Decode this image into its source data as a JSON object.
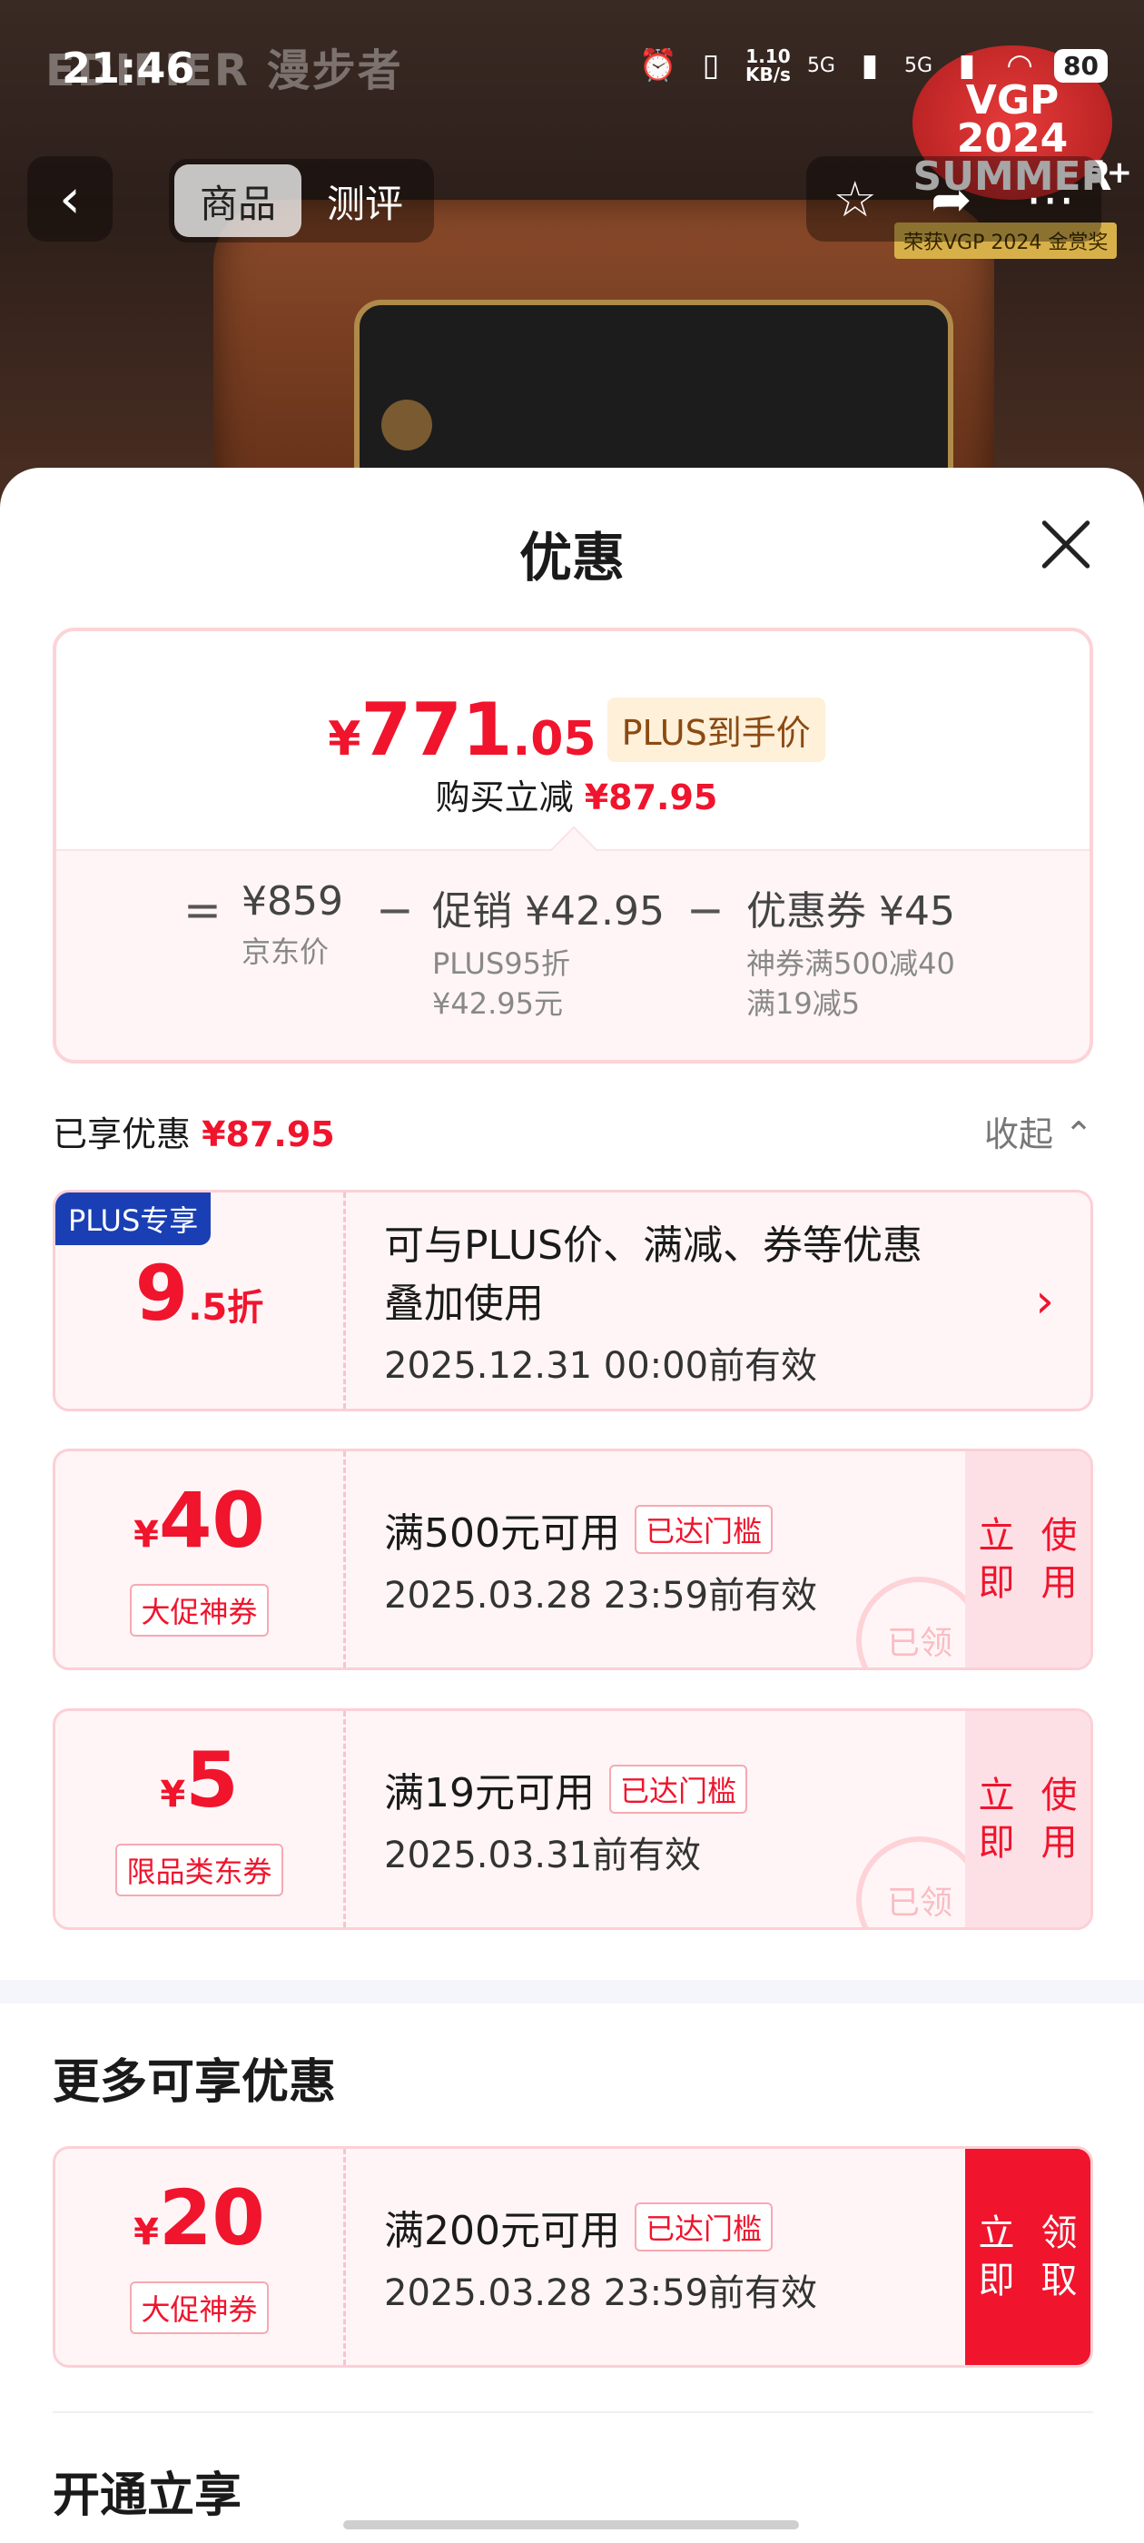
{
  "status_bar": {
    "time": "21:46",
    "net_speed_value": "1.10",
    "net_speed_unit": "KB/s",
    "sig1": "5G",
    "sig2": "5G",
    "battery": "80"
  },
  "header": {
    "brand": "EDIFIER 漫步者",
    "tabs": [
      {
        "label": "商品"
      },
      {
        "label": "测评"
      }
    ],
    "award_text": "VGP 2024 SUMMER",
    "award_count": "5+",
    "award_caption": "荣获VGP 2024 金赏奖"
  },
  "sheet": {
    "title": "优惠",
    "final_price": {
      "yen": "¥",
      "integer": "771",
      "decimal": ".05"
    },
    "plus_tag": "PLUS到手价",
    "buy_save_label": "购买立减",
    "buy_save_amount": "¥87.95",
    "calc": {
      "eq": "=",
      "minus": "−",
      "base_price": "¥859",
      "base_label": "京东价",
      "promo_label": "促销",
      "promo_amount": "¥42.95",
      "promo_note1": "PLUS95折",
      "promo_note2": "¥42.95元",
      "coupon_label": "优惠券",
      "coupon_amount": "¥45",
      "coupon_note1": "神券满500减40",
      "coupon_note2": "满19减5"
    },
    "enjoyed_label": "已享优惠",
    "enjoyed_amount": "¥87.95",
    "collapse_label": "收起"
  },
  "coupons": [
    {
      "badge": "PLUS专享",
      "amount_main": "9",
      "amount_suffix": ".5折",
      "condition": "可与PLUS价、满减、券等优惠",
      "condition2": "叠加使用",
      "valid": "2025.12.31 00:00前有效"
    },
    {
      "yen": "¥",
      "amount_main": "40",
      "kind": "大促神券",
      "condition": "满500元可用",
      "tag": "已达门槛",
      "valid": "2025.03.28 23:59前有效",
      "action": "立即使用",
      "stamp": "已领"
    },
    {
      "yen": "¥",
      "amount_main": "5",
      "kind": "限品类东券",
      "condition": "满19元可用",
      "tag": "已达门槛",
      "valid": "2025.03.31前有效",
      "action": "立即使用",
      "stamp": "已领"
    }
  ],
  "more_section": {
    "title": "更多可享优惠",
    "coupon": {
      "yen": "¥",
      "amount_main": "20",
      "kind": "大促神券",
      "condition": "满200元可用",
      "tag": "已达门槛",
      "valid": "2025.03.28 23:59前有效",
      "action": "立即领取"
    }
  },
  "open_section": {
    "title": "开通立享"
  }
}
